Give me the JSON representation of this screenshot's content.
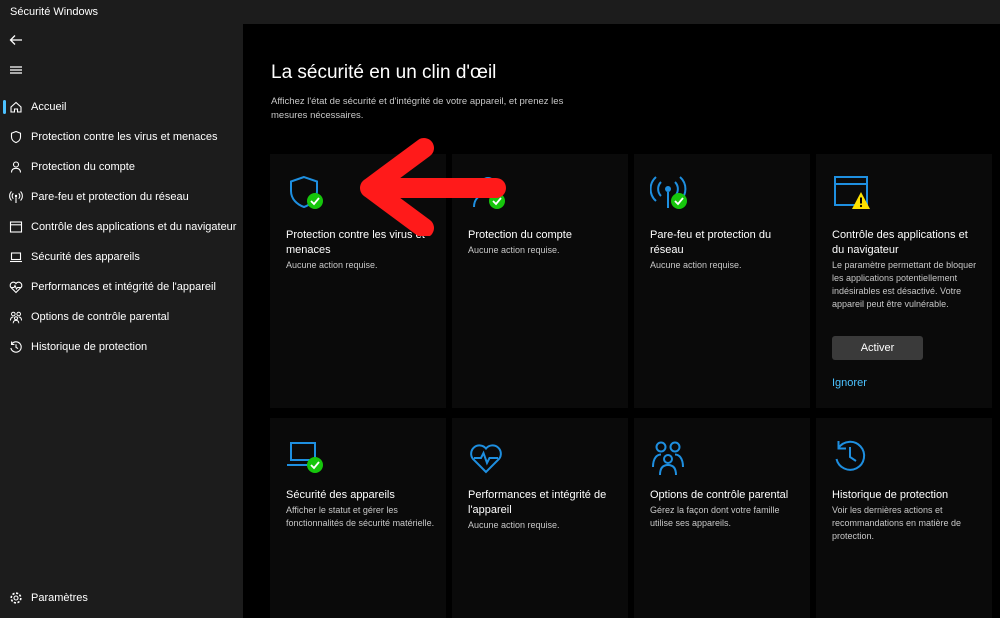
{
  "window": {
    "title": "Sécurité Windows"
  },
  "sidebar": {
    "items": [
      {
        "label": "Accueil"
      },
      {
        "label": "Protection contre les virus et menaces"
      },
      {
        "label": "Protection du compte"
      },
      {
        "label": "Pare-feu et protection du réseau"
      },
      {
        "label": "Contrôle des applications et du navigateur"
      },
      {
        "label": "Sécurité des appareils"
      },
      {
        "label": "Performances et intégrité de l'appareil"
      },
      {
        "label": "Options de contrôle parental"
      },
      {
        "label": "Historique de protection"
      }
    ],
    "settings_label": "Paramètres"
  },
  "main": {
    "title": "La sécurité en un clin d'œil",
    "subtitle": "Affichez l'état de sécurité et d'intégrité de votre appareil, et prenez les mesures nécessaires."
  },
  "cards": [
    {
      "title": "Protection contre les virus et menaces",
      "desc": "Aucune action requise."
    },
    {
      "title": "Protection du compte",
      "desc": "Aucune action requise."
    },
    {
      "title": "Pare-feu et protection du réseau",
      "desc": "Aucune action requise."
    },
    {
      "title": "Contrôle des applications et du navigateur",
      "desc": "Le paramètre permettant de bloquer les applications potentiellement indésirables est désactivé. Votre appareil peut être vulnérable.",
      "action_label": "Activer",
      "dismiss_label": "Ignorer"
    },
    {
      "title": "Sécurité des appareils",
      "desc": "Afficher le statut et gérer les fonctionnalités de sécurité matérielle."
    },
    {
      "title": "Performances et intégrité de l'appareil",
      "desc": "Aucune action requise."
    },
    {
      "title": "Options de contrôle parental",
      "desc": "Gérez la façon dont votre famille utilise ses appareils."
    },
    {
      "title": "Historique de protection",
      "desc": "Voir les dernières actions et recommandations en matière de protection."
    }
  ],
  "colors": {
    "accent": "#4cc2ff",
    "icon_blue": "#1e8fe0",
    "ok_green": "#16c60c",
    "warn_yellow": "#fce100",
    "annotation_red": "#ff1a1a"
  }
}
